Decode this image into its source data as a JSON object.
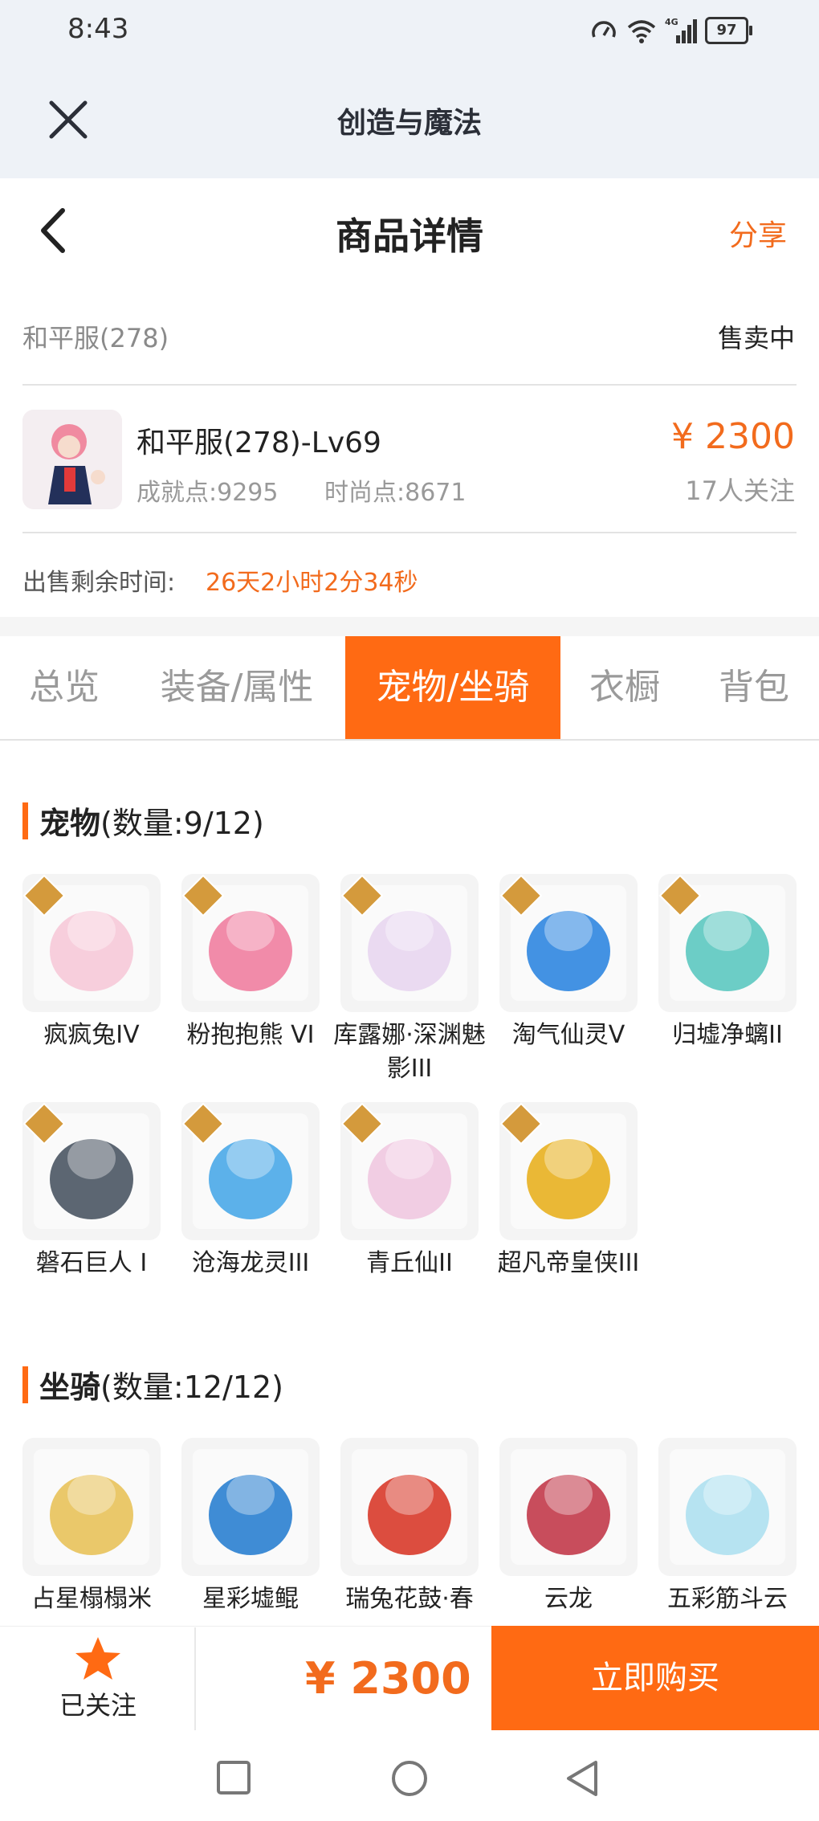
{
  "status_bar": {
    "time": "8:43",
    "network": "4G",
    "battery": "97"
  },
  "app_bar": {
    "title": "创造与魔法"
  },
  "header": {
    "title": "商品详情",
    "share_label": "分享"
  },
  "server": {
    "name": "和平服(278)",
    "status": "售卖中"
  },
  "product": {
    "name": "和平服(278)-Lv69",
    "achievement": "成就点:9295",
    "fashion": "时尚点:8671",
    "price": "¥ 2300",
    "followers": "17人关注"
  },
  "remaining": {
    "label": "出售剩余时间:",
    "value": "26天2小时2分34秒"
  },
  "tabs": [
    {
      "label": "总览"
    },
    {
      "label": "装备/属性"
    },
    {
      "label": "宠物/坐骑"
    },
    {
      "label": "衣橱"
    },
    {
      "label": "背包"
    }
  ],
  "pets": {
    "title": "宠物",
    "count": "(数量:9/12)",
    "items": [
      {
        "label": "疯疯兔IV",
        "tier": "IV",
        "color": "#f6c9d8"
      },
      {
        "label": "粉抱抱熊 VI",
        "tier": "VI",
        "color": "#ef7ea0"
      },
      {
        "label": "库露娜·深渊魅影III",
        "tier": "III",
        "color": "#e8d6f0"
      },
      {
        "label": "淘气仙灵V",
        "tier": "V",
        "color": "#2f86e0"
      },
      {
        "label": "归墟净螭II",
        "tier": "II",
        "color": "#5cc8c0"
      },
      {
        "label": "磐石巨人 I",
        "tier": "I",
        "color": "#4a5563"
      },
      {
        "label": "沧海龙灵III",
        "tier": "III",
        "color": "#4aa8e8"
      },
      {
        "label": "青丘仙II",
        "tier": "II",
        "color": "#f0c8e0"
      },
      {
        "label": "超凡帝皇侠III",
        "tier": "III",
        "color": "#e8b020"
      }
    ]
  },
  "mounts": {
    "title": "坐骑",
    "count": "(数量:12/12)",
    "items": [
      {
        "label": "占星榻榻米",
        "color": "#e8c25a"
      },
      {
        "label": "星彩墟鲲",
        "color": "#2a7fd0"
      },
      {
        "label": "瑞兔花鼓·春",
        "color": "#d83a2a"
      },
      {
        "label": "云龙",
        "color": "#c23a4a"
      },
      {
        "label": "五彩筋斗云",
        "color": "#aee0f0"
      }
    ]
  },
  "bottom_bar": {
    "follow_label": "已关注",
    "price": "¥ 2300",
    "buy_label": "立即购买"
  },
  "colors": {
    "accent": "#ff6a13",
    "price": "#f26b1d"
  }
}
